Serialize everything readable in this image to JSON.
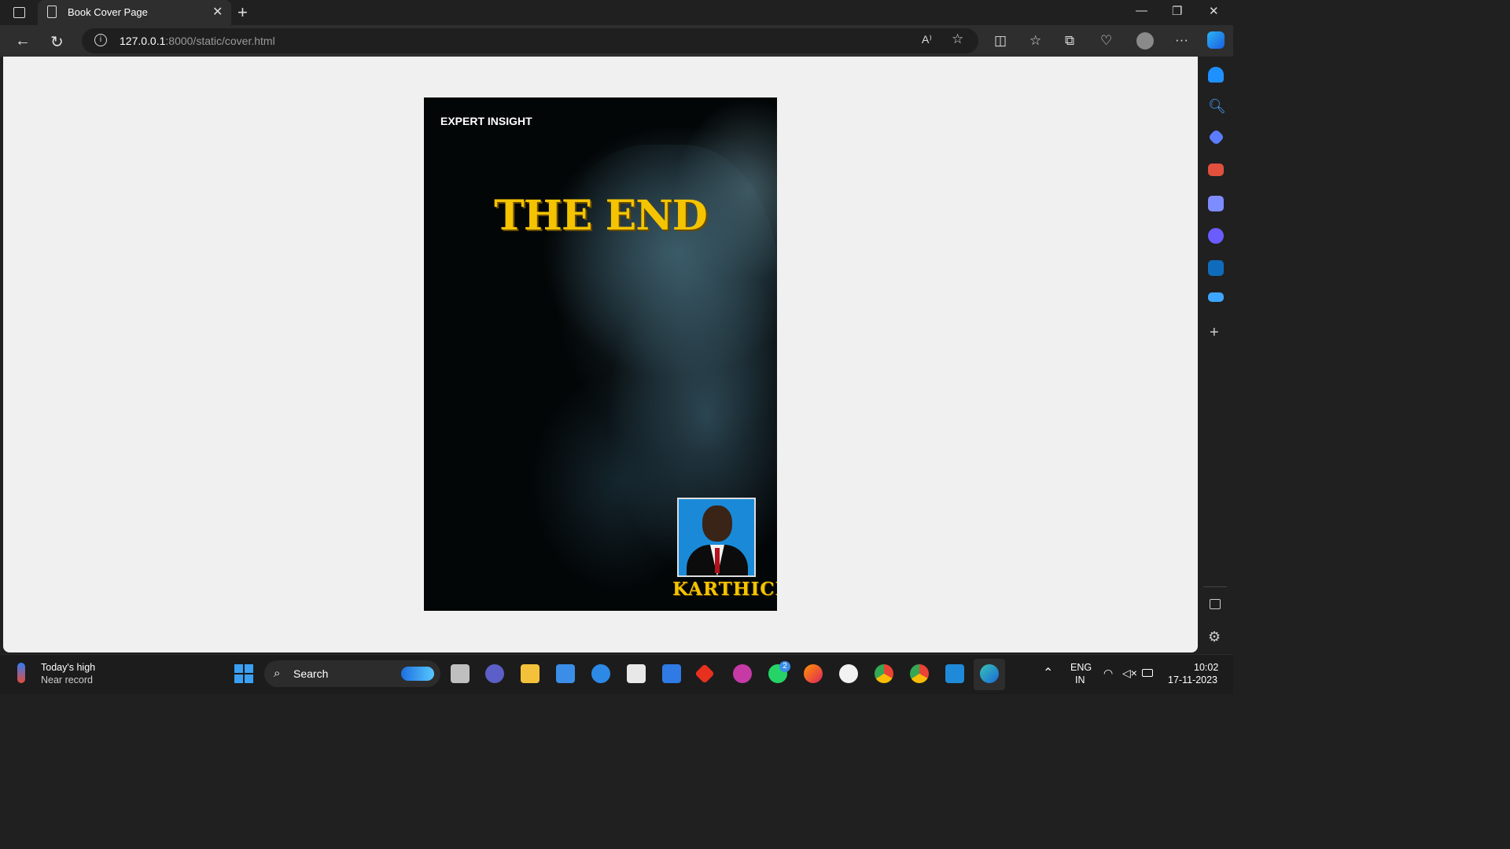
{
  "browser": {
    "tab_title": "Book Cover Page",
    "url_host": "127.0.0.1",
    "url_path": ":8000/static/cover.html"
  },
  "cover": {
    "tag": "EXPERT INSIGHT",
    "title": "THE END",
    "author": "KARTHICK"
  },
  "taskbar": {
    "weather_title": "Today's high",
    "weather_sub": "Near record",
    "search_label": "Search",
    "language": "ENG",
    "region": "IN",
    "time": "10:02",
    "date": "17-11-2023",
    "whatsapp_badge": "2"
  },
  "colors": {
    "title_yellow": "#f5c400",
    "page_bg": "#f0f0f0",
    "chrome_dark": "#202020"
  }
}
